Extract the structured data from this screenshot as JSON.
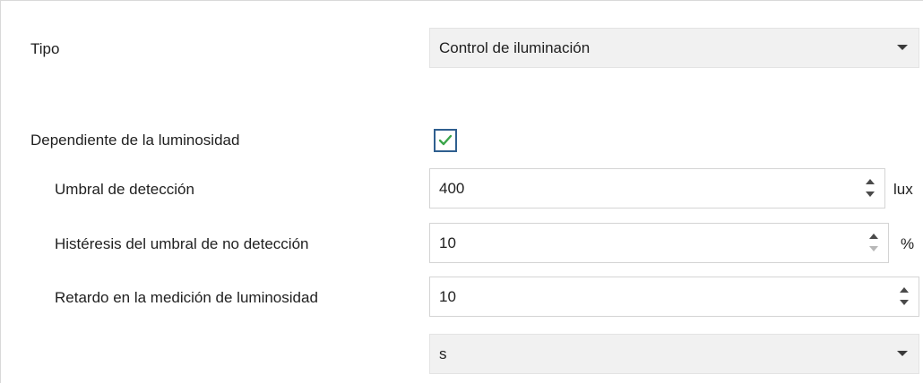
{
  "settings": {
    "tipo": {
      "label": "Tipo",
      "value": "Control de iluminación"
    },
    "dependiente": {
      "label": "Dependiente de la luminosidad",
      "checked": true
    },
    "umbral": {
      "label": "Umbral de detección",
      "value": "400",
      "unit": "lux"
    },
    "histeresis": {
      "label": "Histéresis del umbral de no detección",
      "value": "10",
      "unit": "%"
    },
    "retardo": {
      "label": "Retardo en la medición de luminosidad",
      "value": "10",
      "unit_select": "s"
    }
  },
  "icons": {
    "dropdown": "chevron-down-icon",
    "spinner": "spinner-arrows-icon",
    "check": "check-icon"
  },
  "colors": {
    "check": "#3aa54a",
    "checkbox_border": "#2f5f8f",
    "field_border": "#d4d4d4",
    "select_bg": "#f1f1f1"
  }
}
